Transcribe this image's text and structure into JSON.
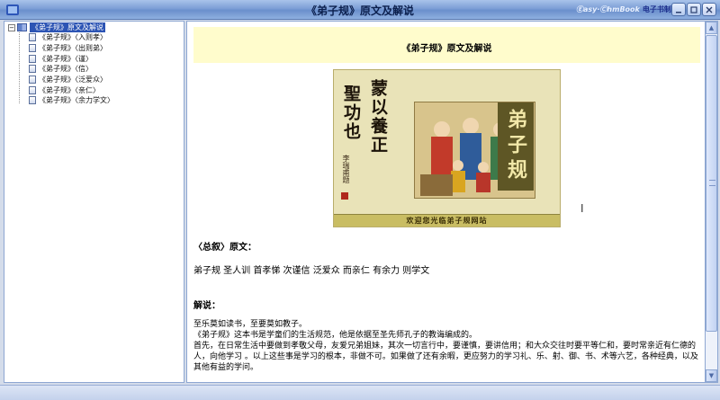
{
  "window": {
    "title": "《弟子规》原文及解说",
    "brand_en": "Ⓔasy·ⒸhmBook",
    "brand_cn": "电子书制作"
  },
  "tree": {
    "root_label": "《弟子规》原文及解说",
    "items": [
      {
        "label": "《弟子规》〈入则孝〉"
      },
      {
        "label": "《弟子规》〈出则弟〉"
      },
      {
        "label": "《弟子规》〈谨〉"
      },
      {
        "label": "《弟子规》〈信〉"
      },
      {
        "label": "《弟子规》〈泛爱众〉"
      },
      {
        "label": "《弟子规》〈亲仁〉"
      },
      {
        "label": "《弟子规》〈余力学文〉"
      }
    ]
  },
  "content": {
    "header_title": "《弟子规》原文及解说",
    "banner": {
      "calligraphy_1": "蒙以養正",
      "calligraphy_2": "聖功也",
      "vertical_brand": "弟子规",
      "signature": "李瑞甫题",
      "footer": "欢迎您光临弟子规网站",
      "accent_color": "#5e5625"
    },
    "summary_title": "〈总叙〉原文：",
    "summary_line": "弟子规  圣人训  首孝悌  次谨信  泛爱众  而亲仁  有余力  则学文",
    "explain_title": "解说：",
    "paragraph_1": "至乐莫如读书，至要莫如教子。",
    "paragraph_2": "《弟子规》这本书是学童们的生活规范，他是依据至圣先师孔子的教诲编成的。",
    "paragraph_3": "首先，在日常生活中要做到孝敬父母，友爱兄弟姐妹，其次一切言行中，要谨慎，要讲信用；和大众交往时要平等仁和，要时常亲近有仁德的人，向他学习 。以上这些事是学习的根本，非做不可。如果做了还有余暇，更应努力的学习礼、乐、射、御、书、术等六艺，各种经典，以及其他有益的学问。"
  }
}
